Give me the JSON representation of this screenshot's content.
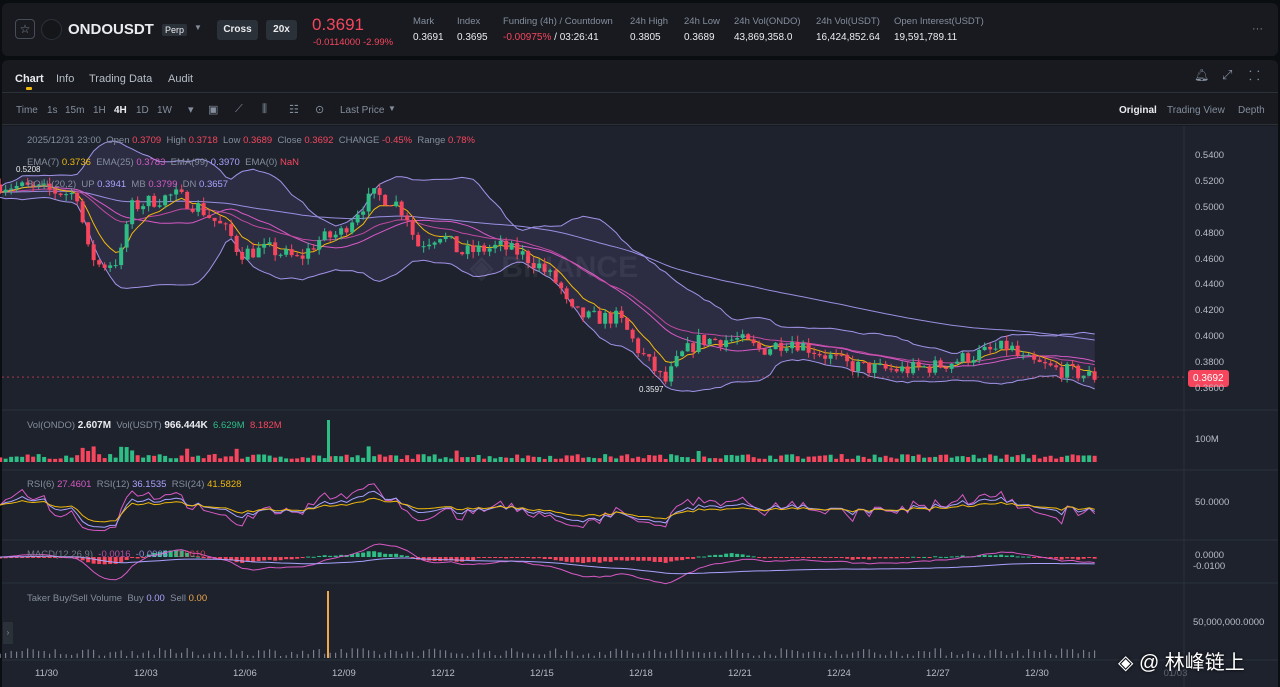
{
  "header": {
    "symbol": "ONDOUSDT",
    "contract": "Perp",
    "margin_mode": "Cross",
    "leverage": "20x",
    "last_price": "0.3691",
    "change": "-0.0114000",
    "change_pct": "-2.99%",
    "stats": [
      {
        "label": "Mark",
        "value": "0.3691"
      },
      {
        "label": "Index",
        "value": "0.3695"
      },
      {
        "label": "Funding (4h) / Countdown",
        "value": "-0.00975%",
        "value2": " / 03:26:41"
      },
      {
        "label": "24h High",
        "value": "0.3805"
      },
      {
        "label": "24h Low",
        "value": "0.3689"
      },
      {
        "label": "24h Vol(ONDO)",
        "value": "43,869,358.0"
      },
      {
        "label": "24h Vol(USDT)",
        "value": "16,424,852.64"
      },
      {
        "label": "Open Interest(USDT)",
        "value": "19,591,789.11"
      }
    ],
    "more": "···"
  },
  "tabs": [
    "Chart",
    "Info",
    "Trading Data",
    "Audit"
  ],
  "toolbar": {
    "intervals": [
      "Time",
      "1s",
      "15m",
      "1H",
      "4H",
      "1D",
      "1W"
    ],
    "active": "4H",
    "price_type": "Last Price",
    "views": [
      "Original",
      "Trading View",
      "Depth"
    ]
  },
  "legend": {
    "date": "2025/12/31 23:00",
    "open_l": "Open",
    "open": "0.3709",
    "high_l": "High",
    "high": "0.3718",
    "low_l": "Low",
    "low": "0.3689",
    "close_l": "Close",
    "close": "0.3692",
    "change_l": "CHANGE",
    "change": "-0.45%",
    "range_l": "Range",
    "range": "0.78%",
    "ema7_l": "EMA(7)",
    "ema7": "0.3736",
    "ema25_l": "EMA(25)",
    "ema25": "0.3783",
    "ema99_l": "EMA(99)",
    "ema99": "0.3970",
    "ema0_l": "EMA(0)",
    "ema0": "NaN",
    "boll_l": "BOLL(20,2)",
    "up_l": "UP",
    "up": "0.3941",
    "mb_l": "MB",
    "mb": "0.3799",
    "dn_l": "DN",
    "dn": "0.3657"
  },
  "markers": {
    "high": "0.5208",
    "low": "0.3597",
    "current": "0.3692"
  },
  "price_axis": [
    "0.5400",
    "0.5200",
    "0.5000",
    "0.4800",
    "0.4600",
    "0.4400",
    "0.4200",
    "0.4000",
    "0.3800",
    "0.3600"
  ],
  "volume": {
    "l1": "Vol(ONDO)",
    "v1": "2.607M",
    "l2": "Vol(USDT)",
    "v2": "966.444K",
    "v3": "6.629M",
    "v4": "8.182M",
    "axis": "100M"
  },
  "rsi": {
    "l6": "RSI(6)",
    "v6": "27.4601",
    "l12": "RSI(12)",
    "v12": "36.1535",
    "l24": "RSI(24)",
    "v24": "41.5828",
    "axis": "50.0000"
  },
  "macd": {
    "label": "MACD(12,26,9)",
    "dif": "-0.0016",
    "dea": "-0.0006",
    "hist": "-0.0010",
    "axis1": "0.0000",
    "axis2": "-0.0100"
  },
  "taker": {
    "label": "Taker Buy/Sell Volume",
    "buy_l": "Buy",
    "buy": "0.00",
    "sell_l": "Sell",
    "sell": "0.00",
    "axis": "50,000,000.0000"
  },
  "x_axis": [
    "11/30",
    "12/03",
    "12/06",
    "12/09",
    "12/12",
    "12/15",
    "12/18",
    "12/21",
    "12/24",
    "12/27",
    "12/30",
    "01/03"
  ],
  "watermark": "@ 林峰链上",
  "chart_data": {
    "type": "candlestick",
    "interval": "4H",
    "ylim": [
      0.355,
      0.545
    ],
    "close_waypoints": [
      [
        -1.45,
        0.518
      ],
      [
        0.97,
        0.51
      ],
      [
        1.12,
        0.47
      ],
      [
        1.58,
        0.455
      ],
      [
        2.18,
        0.46
      ],
      [
        2.48,
        0.5
      ],
      [
        3.09,
        0.505
      ],
      [
        3.85,
        0.51
      ],
      [
        4.6,
        0.5
      ],
      [
        5.5,
        0.48
      ],
      [
        5.8,
        0.465
      ],
      [
        6.7,
        0.468
      ],
      [
        7.6,
        0.46
      ],
      [
        8.2,
        0.475
      ],
      [
        8.85,
        0.48
      ],
      [
        9.45,
        0.5
      ],
      [
        9.9,
        0.51
      ],
      [
        10.5,
        0.505
      ],
      [
        11.0,
        0.49
      ],
      [
        11.1,
        0.47
      ],
      [
        11.9,
        0.48
      ],
      [
        12.5,
        0.465
      ],
      [
        13.7,
        0.47
      ],
      [
        14.3,
        0.465
      ],
      [
        14.9,
        0.455
      ],
      [
        15.5,
        0.44
      ],
      [
        15.8,
        0.42
      ],
      [
        16.4,
        0.415
      ],
      [
        17.3,
        0.415
      ],
      [
        17.9,
        0.39
      ],
      [
        18.7,
        0.365
      ],
      [
        19.15,
        0.385
      ],
      [
        19.75,
        0.398
      ],
      [
        20.95,
        0.398
      ],
      [
        21.6,
        0.39
      ],
      [
        22.5,
        0.398
      ],
      [
        23.4,
        0.388
      ],
      [
        24.3,
        0.378
      ],
      [
        25.2,
        0.375
      ],
      [
        26.0,
        0.375
      ],
      [
        27.0,
        0.378
      ],
      [
        27.9,
        0.385
      ],
      [
        29.15,
        0.393
      ],
      [
        29.45,
        0.383
      ],
      [
        30.4,
        0.376
      ],
      [
        31.8,
        0.369
      ]
    ]
  },
  "colors": {
    "up": "#2ebd85",
    "down": "#f6465d",
    "accent": "#f0b90b"
  }
}
